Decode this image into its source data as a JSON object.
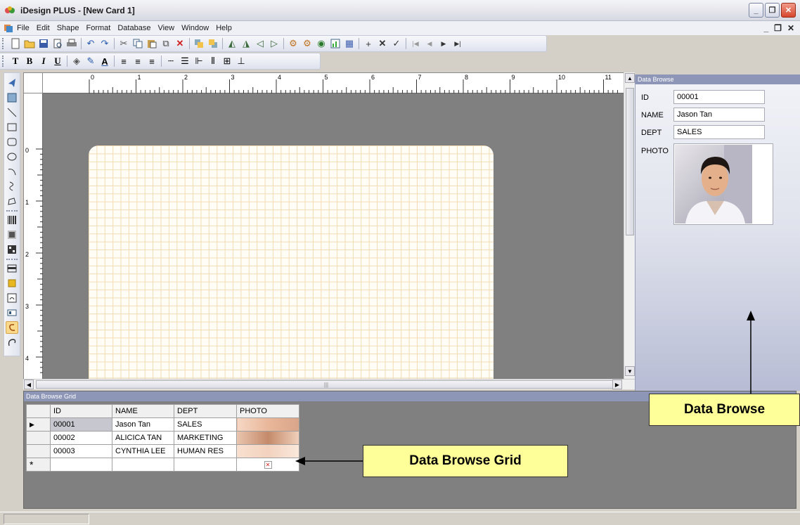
{
  "window": {
    "title": "iDesign PLUS - [New Card 1]"
  },
  "menu": {
    "items": [
      "File",
      "Edit",
      "Shape",
      "Format",
      "Database",
      "View",
      "Window",
      "Help"
    ]
  },
  "ruler": {
    "h_numbers": [
      "0",
      "1",
      "2",
      "3",
      "4",
      "5",
      "6",
      "7",
      "8",
      "9",
      "10",
      "11"
    ],
    "v_numbers": [
      "0",
      "1",
      "2",
      "3",
      "4"
    ]
  },
  "data_browse": {
    "header": "Data Browse",
    "fields": [
      {
        "label": "ID",
        "value": "00001"
      },
      {
        "label": "NAME",
        "value": "Jason Tan"
      },
      {
        "label": "DEPT",
        "value": "SALES"
      }
    ],
    "photo_label": "PHOTO"
  },
  "grid": {
    "header": "Data Browse Grid",
    "columns": [
      "ID",
      "NAME",
      "DEPT",
      "PHOTO"
    ],
    "rows": [
      {
        "id": "00001",
        "name": "Jason Tan",
        "dept": "SALES"
      },
      {
        "id": "00002",
        "name": "ALICICA TAN",
        "dept": "MARKETING"
      },
      {
        "id": "00003",
        "name": "CYNTHIA LEE",
        "dept": "HUMAN RES"
      }
    ],
    "new_row_marker": "*"
  },
  "callouts": {
    "data_browse": "Data Browse",
    "data_browse_grid": "Data Browse Grid"
  },
  "colors": {
    "panel_header": "#8e96b8",
    "callout_fill": "#ffff99",
    "canvas_bg": "#808080"
  }
}
